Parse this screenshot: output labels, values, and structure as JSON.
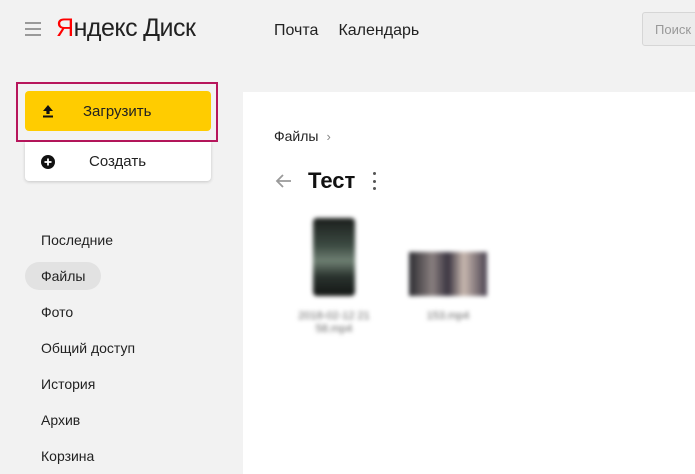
{
  "header": {
    "logo_y": "Я",
    "logo_rest": "ндекс",
    "logo_service": "Диск",
    "nav": [
      "Почта",
      "Календарь"
    ],
    "search_placeholder": "Поиск"
  },
  "actions": {
    "upload_label": "Загрузить",
    "create_label": "Создать"
  },
  "sidebar": {
    "items": [
      {
        "label": "Последние",
        "active": false
      },
      {
        "label": "Файлы",
        "active": true
      },
      {
        "label": "Фото",
        "active": false
      },
      {
        "label": "Общий доступ",
        "active": false
      },
      {
        "label": "История",
        "active": false
      },
      {
        "label": "Архив",
        "active": false
      },
      {
        "label": "Корзина",
        "active": false
      }
    ]
  },
  "main": {
    "breadcrumb": "Файлы",
    "breadcrumb_sep": "›",
    "folder_title": "Тест",
    "files": [
      {
        "caption_line1": "2018-02-12 21",
        "caption_line2": "58.mp4"
      },
      {
        "caption_line1": "153.mp4",
        "caption_line2": ""
      }
    ]
  },
  "colors": {
    "upload_button": "#ffcc00",
    "highlight_frame": "#b7165c",
    "logo_red": "#ff0000"
  },
  "icons": {
    "menu": "burger-menu-icon",
    "upload": "upload-arrow-icon",
    "create": "plus-circle-icon",
    "back": "arrow-left-icon",
    "more": "vertical-dots-icon"
  }
}
